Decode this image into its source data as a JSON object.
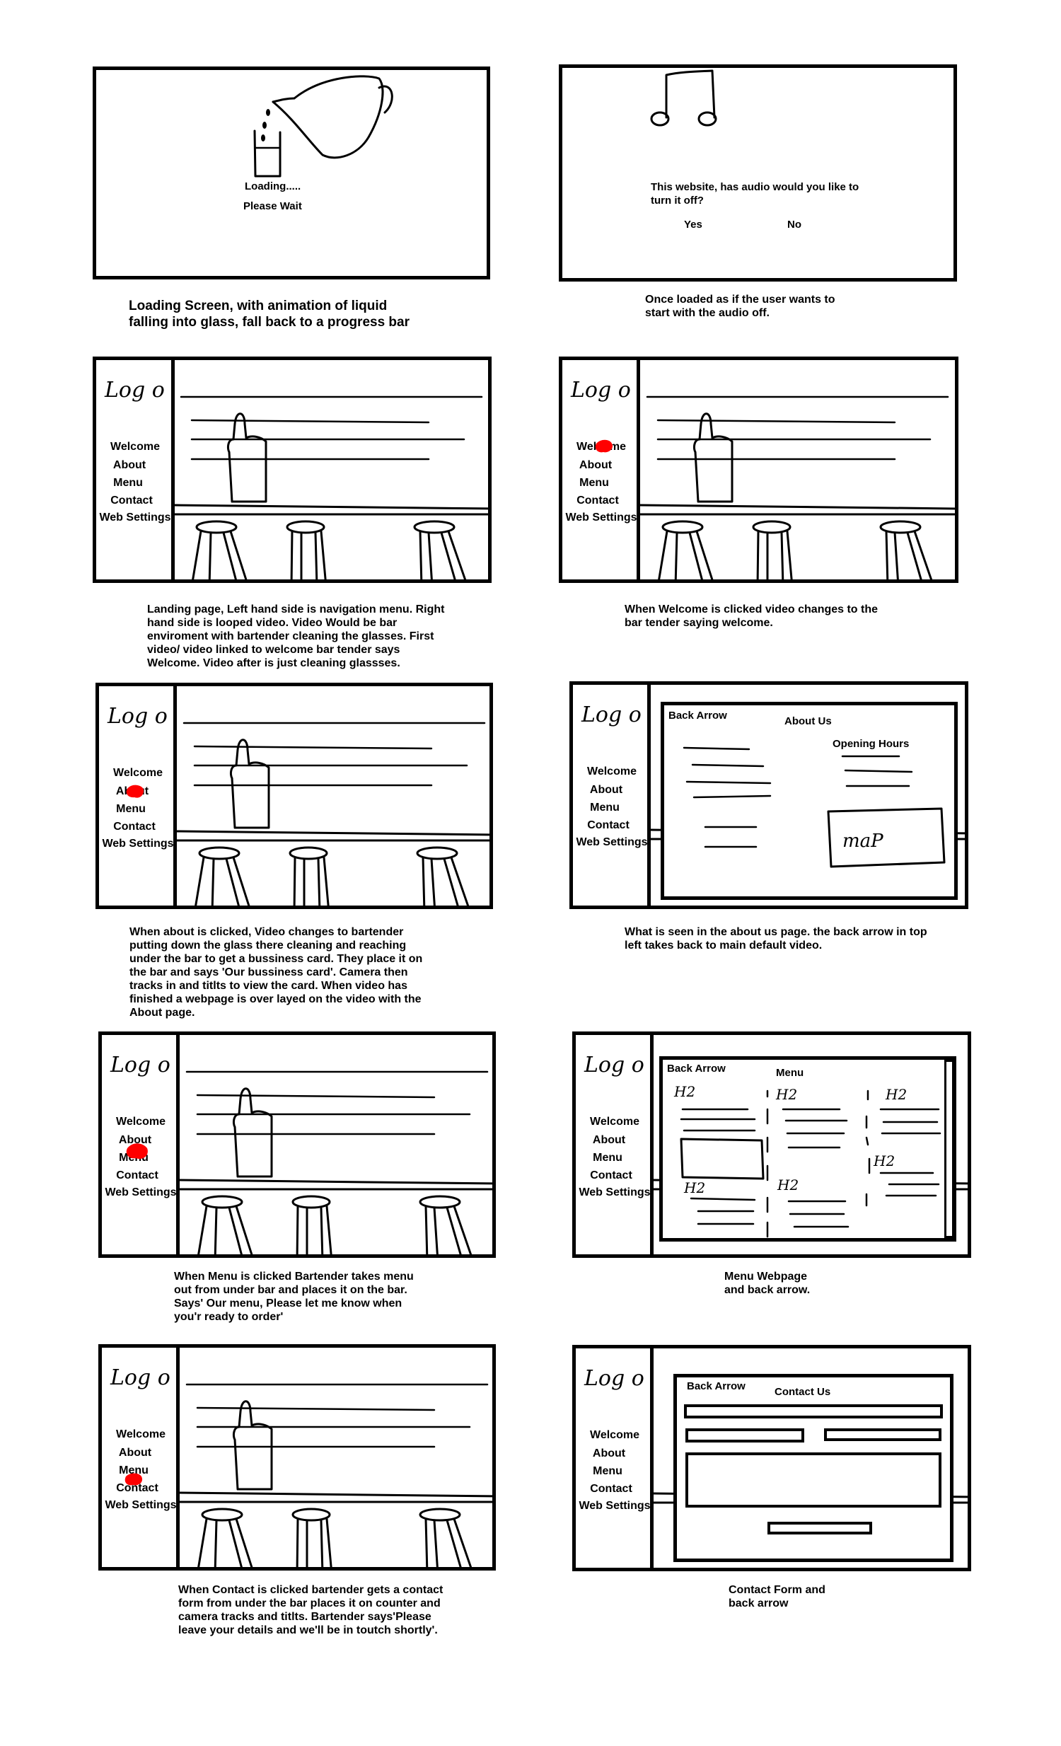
{
  "panels": {
    "loading": {
      "loading_text": "Loading.....",
      "wait_text": "Please Wait",
      "caption": "Loading Screen, with animation of liquid\nfalling into glass, fall back to a progress bar"
    },
    "audio": {
      "question": "This website, has audio would you like to\nturn it off?",
      "yes": "Yes",
      "no": "No",
      "caption": "Once loaded as if the user wants to\nstart with the audio off."
    },
    "landing": {
      "caption": "Landing page, Left hand side is navigation menu. Right\nhand side is looped video. Video Would be bar\nenviroment with bartender cleaning the glasses. First\nvideo/ video linked to welcome bar tender says\nWelcome. Video after is just cleaning glassses."
    },
    "welcome": {
      "caption": "When Welcome is clicked video changes to the\nbar tender saying welcome."
    },
    "about_click": {
      "caption": "When about is clicked, Video changes to bartender\nputting down the glass there cleaning and reaching\nunder the bar to get a bussiness card. They place it on\nthe bar and says 'Our bussiness card'. Camera then\ntracks in and titlts to view the card. When video has\nfinished a webpage is over layed on the video with the\nAbout page."
    },
    "about_page": {
      "back": "Back Arrow",
      "title": "About Us",
      "hours": "Opening Hours",
      "map": "maP",
      "caption": "What is seen in the about us page. the back arrow in top\nleft takes back to main default video."
    },
    "menu_click": {
      "caption": "When Menu is clicked Bartender takes menu\nout from under bar and places it on the bar.\nSays' Our menu, Please let me know when\nyou'r ready to order'"
    },
    "menu_page": {
      "back": "Back Arrow",
      "title": "Menu",
      "h2": "H2",
      "caption": "Menu Webpage\nand back arrow."
    },
    "contact_click": {
      "caption": "When Contact is clicked bartender gets a contact\nform from under the bar places it on counter and\ncamera tracks and titlts. Bartender says'Please\nleave your details and we'll be in toutch shortly'."
    },
    "contact_page": {
      "back": "Back Arrow",
      "title": "Contact Us",
      "caption": "Contact Form and\nback arrow"
    }
  },
  "logo": "Logo",
  "nav": [
    "Welcome",
    "About",
    "Menu",
    "Contact",
    "Web Settings"
  ]
}
